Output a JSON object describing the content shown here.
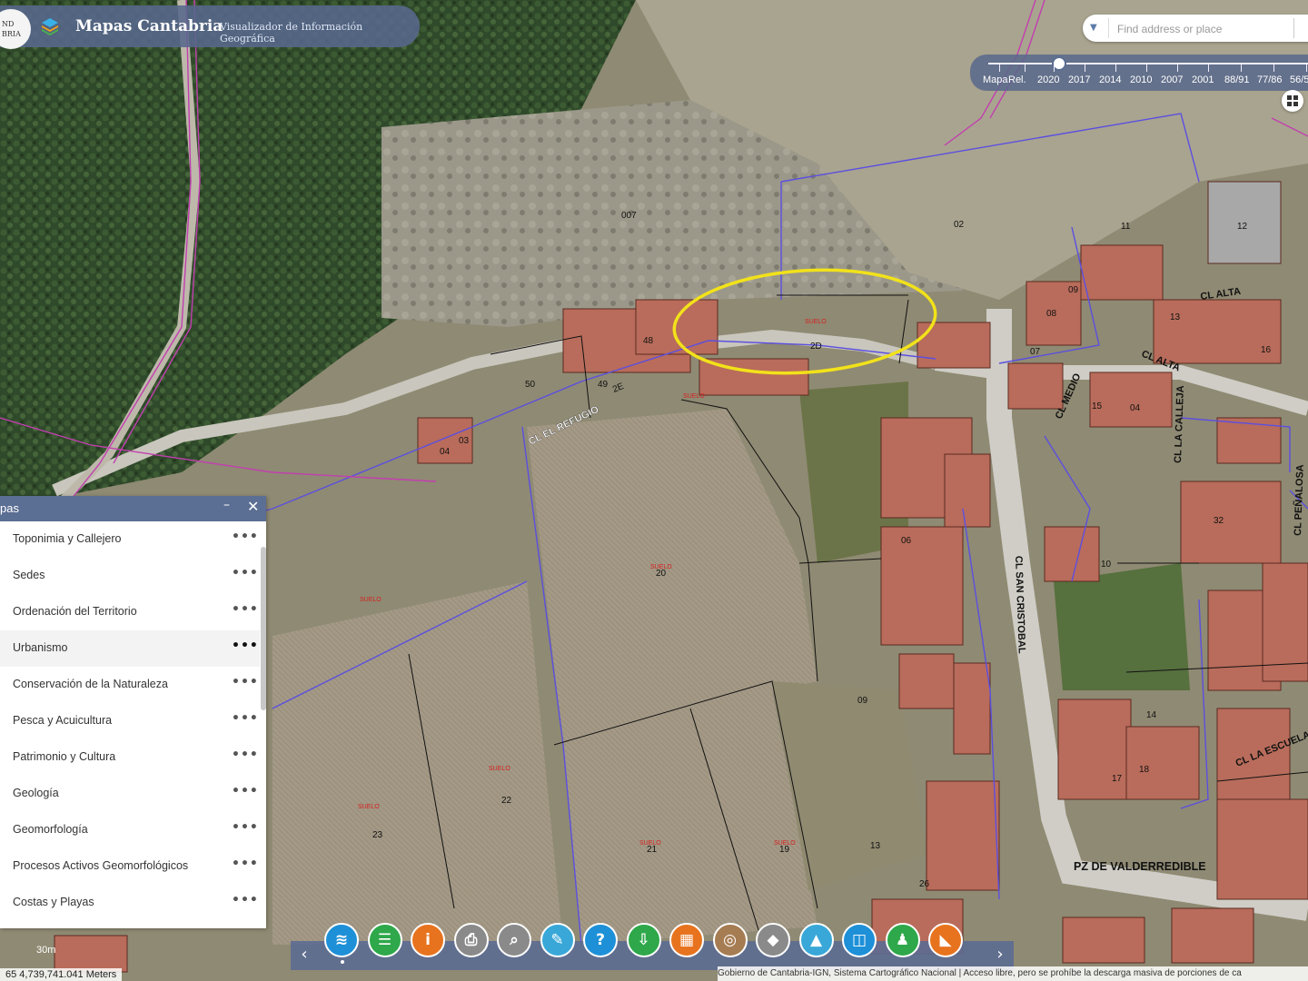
{
  "app": {
    "logo_line1": "ND",
    "logo_line2": "BRIA",
    "title": "Mapas Cantabria",
    "subtitle": "Visualizador de Información Geográfica"
  },
  "search": {
    "placeholder": "Find address or place"
  },
  "timeline": {
    "labels": [
      "Mapa",
      "Rel.",
      "2020",
      "2017",
      "2014",
      "2010",
      "2007",
      "2001",
      "88/91",
      "77/86",
      "56/5"
    ],
    "selected": "2020"
  },
  "panel": {
    "title": "pas",
    "minimize": "–",
    "close": "✕",
    "more": "•••",
    "items": [
      {
        "label": "Toponimia y Callejero"
      },
      {
        "label": "Sedes"
      },
      {
        "label": "Ordenación del Territorio"
      },
      {
        "label": "Urbanismo"
      },
      {
        "label": "Conservación de la Naturaleza"
      },
      {
        "label": "Pesca y Acuicultura"
      },
      {
        "label": "Patrimonio y Cultura"
      },
      {
        "label": "Geología"
      },
      {
        "label": "Geomorfología"
      },
      {
        "label": "Procesos Activos Geomorfológicos"
      },
      {
        "label": "Costas y Playas"
      }
    ]
  },
  "map_labels": {
    "street_refugio": "CL EL REFUGIO",
    "street_san_cristobal": "CL SAN CRISTOBAL",
    "street_alta1": "CL ALTA",
    "street_alta2": "CL ALTA",
    "street_medio": "CL MEDIO",
    "street_calleja": "CL LA CALLEJA",
    "street_penalosa": "CL PEÑALOSA",
    "street_escuela": "CL LA ESCUELA",
    "plaza": "PZ DE VALDERREDIBLE",
    "parcels": [
      "48",
      "49",
      "50",
      "04",
      "03",
      "007",
      "02",
      "11",
      "12",
      "09",
      "08",
      "13",
      "16",
      "15",
      "06",
      "04",
      "07",
      "10",
      "32",
      "20",
      "22",
      "23",
      "21",
      "19",
      "09",
      "18",
      "17",
      "14",
      "13",
      "26",
      "2D",
      "2E",
      "SUELO"
    ]
  },
  "toolbar": {
    "prev": "‹",
    "next": "›",
    "buttons": [
      {
        "icon": "layers-icon",
        "glyph": "≋",
        "color": "#1e90d8"
      },
      {
        "icon": "list-icon",
        "glyph": "☰",
        "color": "#2ea84a"
      },
      {
        "icon": "info-icon",
        "glyph": "i",
        "color": "#e8731e"
      },
      {
        "icon": "print-icon",
        "glyph": "⎙",
        "color": "#8a8a8a"
      },
      {
        "icon": "query-icon",
        "glyph": "⌕",
        "color": "#8a8a8a"
      },
      {
        "icon": "draw-icon",
        "glyph": "✎",
        "color": "#39a8d8"
      },
      {
        "icon": "help-icon",
        "glyph": "?",
        "color": "#1e90d8"
      },
      {
        "icon": "download-icon",
        "glyph": "⇩",
        "color": "#2ea84a"
      },
      {
        "icon": "grid-icon",
        "glyph": "▦",
        "color": "#e8731e"
      },
      {
        "icon": "measure-icon",
        "glyph": "◎",
        "color": "#a67c52"
      },
      {
        "icon": "direction-icon",
        "glyph": "◆",
        "color": "#8a8a8a"
      },
      {
        "icon": "profile-icon",
        "glyph": "▲",
        "color": "#39a8d8"
      },
      {
        "icon": "swipe-icon",
        "glyph": "◫",
        "color": "#1e90d8"
      },
      {
        "icon": "person-icon",
        "glyph": "♟",
        "color": "#2ea84a"
      },
      {
        "icon": "brand-icon",
        "glyph": "◣",
        "color": "#e8731e"
      }
    ]
  },
  "footer": {
    "coords": "65 4,739,741.041 Meters",
    "scale": "30m",
    "attribution": "Gobierno de Cantabria-IGN, Sistema Cartográfico Nacional | Acceso libre, pero se prohíbe la descarga masiva de porciones de ca"
  }
}
